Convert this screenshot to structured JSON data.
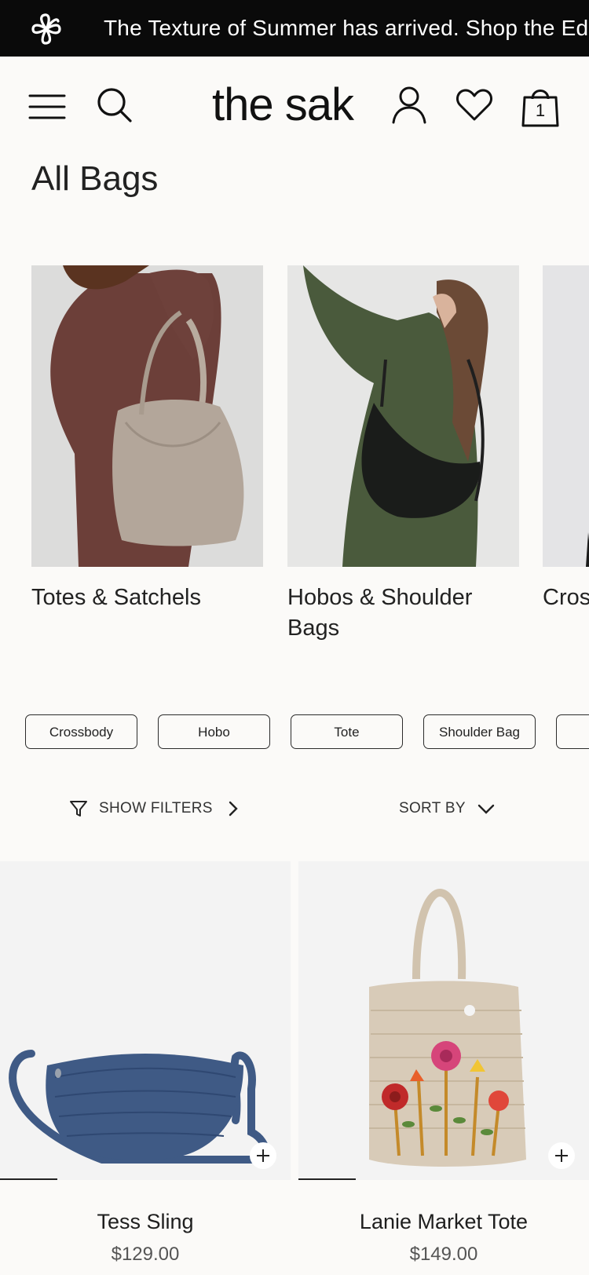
{
  "announcement": {
    "logo_icon": "flower-knot-logo",
    "message": "The Texture of Summer has arrived. Shop the Edit"
  },
  "header": {
    "brand": "the sak",
    "menu_icon": "hamburger-menu-icon",
    "search_icon": "search-icon",
    "account_icon": "user-icon",
    "wishlist_icon": "heart-icon",
    "cart_icon": "shopping-bag-icon",
    "cart_count": "1"
  },
  "page": {
    "title": "All Bags"
  },
  "categories": [
    {
      "label": "Totes & Satchels"
    },
    {
      "label": "Hobos & Shoulder Bags"
    },
    {
      "label": "Cros"
    }
  ],
  "chips": [
    {
      "label": "Crossbody"
    },
    {
      "label": "Hobo"
    },
    {
      "label": "Tote"
    },
    {
      "label": "Shoulder Bag"
    },
    {
      "label": ""
    }
  ],
  "controls": {
    "filters_label": "SHOW FILTERS",
    "sort_label": "SORT BY"
  },
  "products": [
    {
      "name": "Tess Sling",
      "price": "$129.00",
      "color": "#3f5a85"
    },
    {
      "name": "Lanie Market Tote",
      "price": "$149.00",
      "color": "#d8cbb8"
    }
  ],
  "colors": {
    "background": "#fbfaf8",
    "announcement_bg": "#0a0a0a",
    "text": "#1a1a1a"
  }
}
